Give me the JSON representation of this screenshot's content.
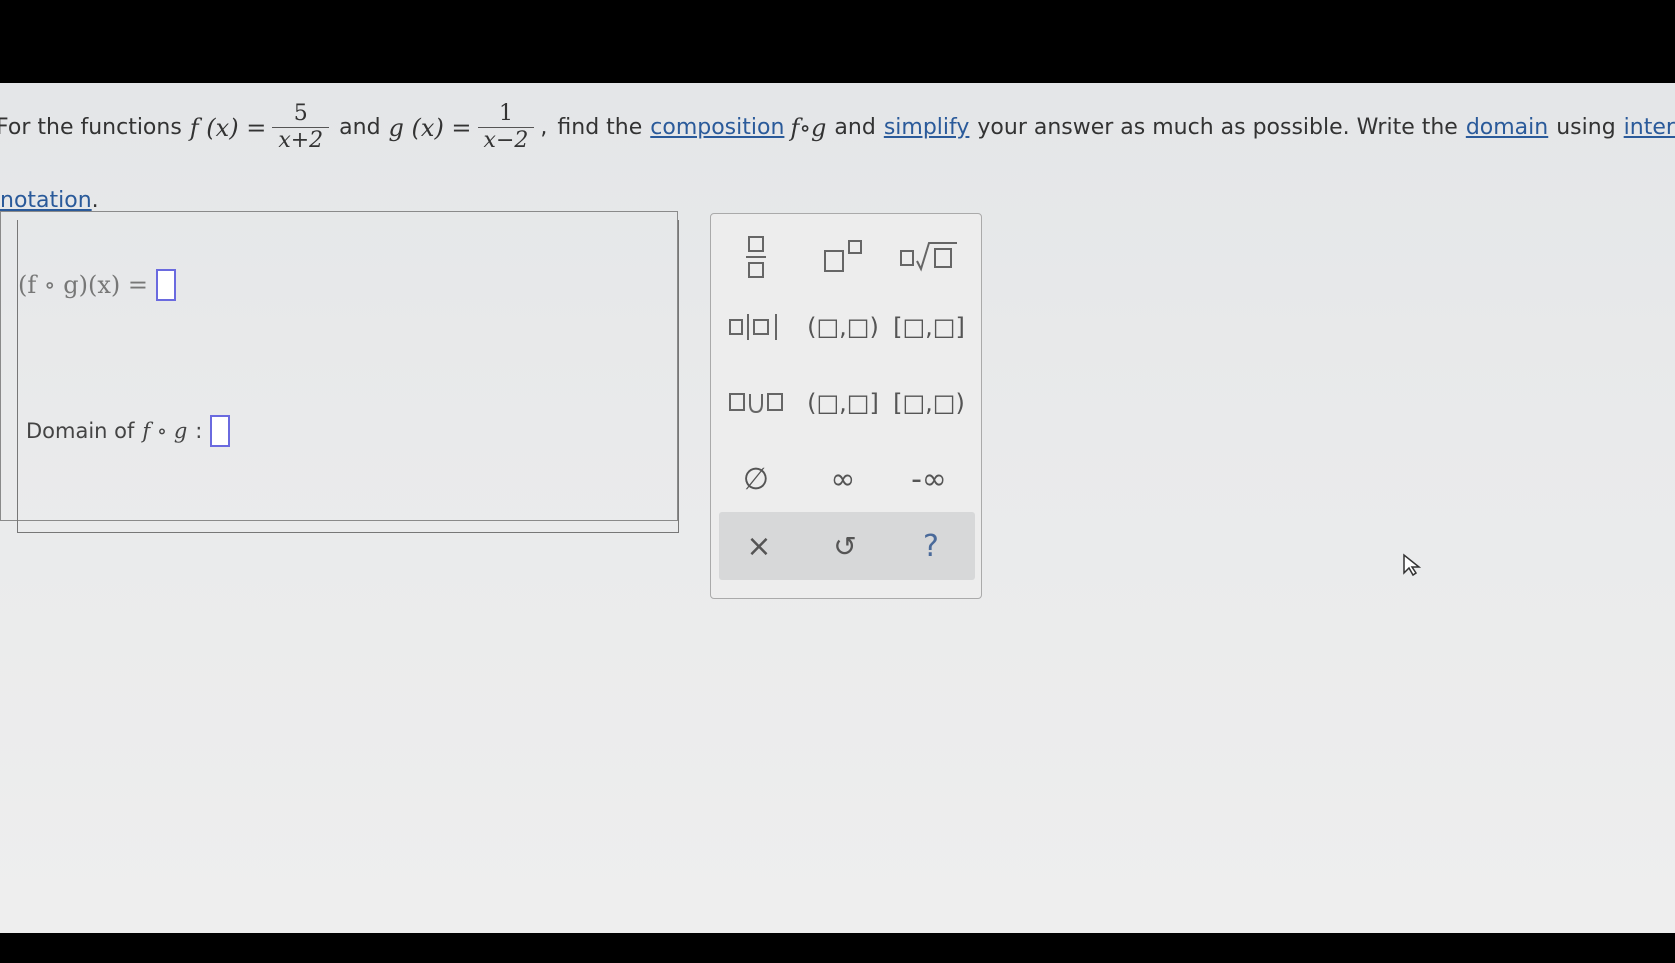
{
  "problem": {
    "intro": "For the functions",
    "f_label": "f (x) =",
    "f_num": "5",
    "f_den": "x+2",
    "and": "and",
    "g_label": "g (x) =",
    "g_num": "1",
    "g_den": "x−2",
    "comma": ",",
    "find_the": "find the",
    "composition_link": "composition",
    "fog_symbol": "f∘g",
    "and_2": "and",
    "simplify_link": "simplify",
    "rest": "your answer as much as possible. Write the",
    "domain_link": "domain",
    "using": "using",
    "interval_link": "interv",
    "notation_link": "notation",
    "period": "."
  },
  "answer": {
    "fog_label": "(f ∘ g)(x) =",
    "domain_label": "Domain of",
    "domain_fog": "f ∘ g",
    "colon": ":"
  },
  "palette": {
    "row2": [
      "(□,□)",
      "[□,□]"
    ],
    "row3": [
      "(□,□]",
      "[□,□)"
    ],
    "empty_set": "∅",
    "infinity": "∞",
    "neg_infinity": "-∞",
    "clear": "×",
    "undo": "↺",
    "help": "?"
  },
  "colors": {
    "link": "#2a5a9a",
    "slot_border": "#6a6adf"
  }
}
